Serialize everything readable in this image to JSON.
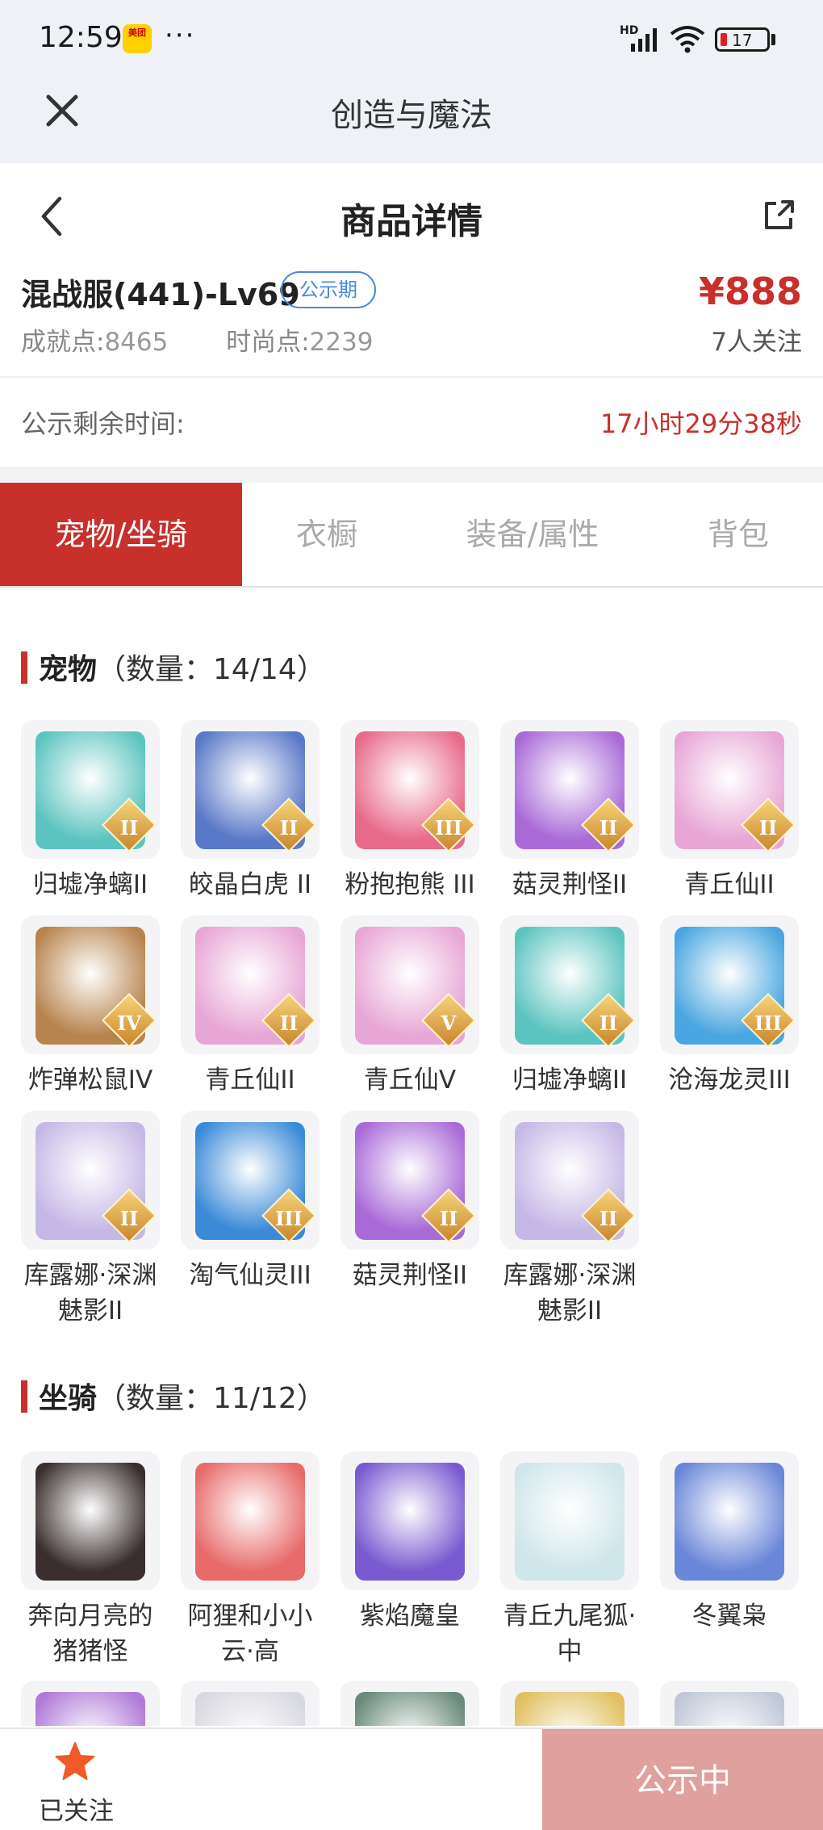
{
  "status_bar": {
    "time": "12:59",
    "app_badge": "美团",
    "more": "···",
    "network": "HD",
    "battery": "17"
  },
  "app_bar": {
    "title": "创造与魔法"
  },
  "header": {
    "title": "商品详情"
  },
  "product": {
    "name": "混战服(441)-Lv69",
    "badge": "公示期",
    "achievement_label": "成就点:",
    "achievement_value": "8465",
    "fashion_label": "时尚点:",
    "fashion_value": "2239",
    "price": "¥888",
    "followers": "7人关注"
  },
  "countdown": {
    "label": "公示剩余时间:",
    "value": "17小时29分38秒"
  },
  "tabs": [
    {
      "label": "宠物/坐骑",
      "active": true
    },
    {
      "label": "衣橱",
      "active": false
    },
    {
      "label": "装备/属性",
      "active": false
    },
    {
      "label": "背包",
      "active": false
    }
  ],
  "pets": {
    "title": "宠物",
    "count": "（数量：14/14）",
    "items": [
      {
        "label": "归墟净螭II",
        "rank": "II",
        "color": "#5cc4c0"
      },
      {
        "label": "皎晶白虎 II",
        "rank": "II",
        "color": "#5a78c8"
      },
      {
        "label": "粉抱抱熊 III",
        "rank": "III",
        "color": "#e86a8a"
      },
      {
        "label": "菇灵荆怪II",
        "rank": "II",
        "color": "#a96ad8"
      },
      {
        "label": "青丘仙II",
        "rank": "II",
        "color": "#e8a6d6"
      },
      {
        "label": "炸弹松鼠IV",
        "rank": "IV",
        "color": "#b8844e"
      },
      {
        "label": "青丘仙II",
        "rank": "II",
        "color": "#e8a6d6"
      },
      {
        "label": "青丘仙V",
        "rank": "V",
        "color": "#e8a6d6"
      },
      {
        "label": "归墟净螭II",
        "rank": "II",
        "color": "#5cc4c0"
      },
      {
        "label": "沧海龙灵III",
        "rank": "III",
        "color": "#4aa6e0"
      },
      {
        "label": "库露娜·深渊魅影II",
        "rank": "II",
        "color": "#c6b8e6"
      },
      {
        "label": "淘气仙灵III",
        "rank": "III",
        "color": "#3a8ad8"
      },
      {
        "label": "菇灵荆怪II",
        "rank": "II",
        "color": "#a96ad8"
      },
      {
        "label": "库露娜·深渊魅影II",
        "rank": "II",
        "color": "#c6b8e6"
      }
    ]
  },
  "mounts": {
    "title": "坐骑",
    "count": "（数量：11/12）",
    "items": [
      {
        "label": "奔向月亮的猪猪怪",
        "color": "#3a2e2e"
      },
      {
        "label": "阿狸和小小云·高",
        "color": "#e86a6a"
      },
      {
        "label": "紫焰魔皇",
        "color": "#7a5ad0"
      },
      {
        "label": "青丘九尾狐·中",
        "color": "#cfe6ea"
      },
      {
        "label": "冬翼枭",
        "color": "#6a86d8"
      },
      {
        "label": "",
        "color": "#b07ad8"
      },
      {
        "label": "",
        "color": "#d8d8e0"
      },
      {
        "label": "",
        "color": "#6a8a7a"
      },
      {
        "label": "",
        "color": "#e0c060"
      },
      {
        "label": "",
        "color": "#c0c8d8"
      }
    ]
  },
  "bottom": {
    "follow_label": "已关注",
    "status_button": "公示中"
  }
}
